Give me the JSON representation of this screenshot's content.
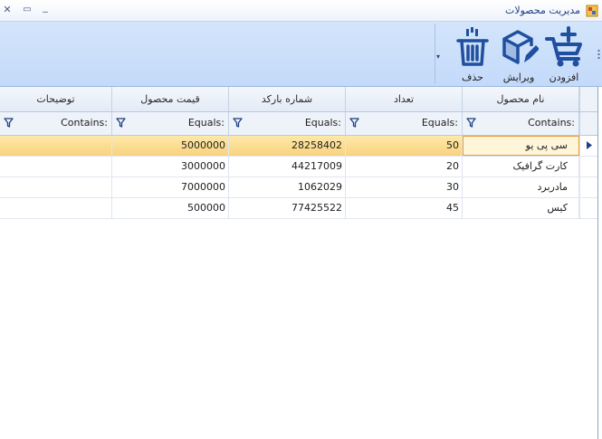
{
  "window": {
    "title": "مدیریت محصولات",
    "close_glyph": "✕",
    "restore_glyph": "▭",
    "minimize_glyph": "_"
  },
  "toolbar": {
    "add_label": "افزودن",
    "edit_label": "ویرایش",
    "delete_label": "حذف",
    "overflow_glyph": "▾"
  },
  "grid": {
    "columns": [
      "نام محصول",
      "تعداد",
      "شماره بارکد",
      "قیمت محصول",
      "توضیحات"
    ],
    "filters": [
      "Contains:",
      "Equals:",
      "Equals:",
      "Equals:",
      "Contains:"
    ],
    "rows": [
      [
        "سی پی یو",
        "50",
        "28258402",
        "5000000",
        ""
      ],
      [
        "کارت گرافیک",
        "20",
        "44217009",
        "3000000",
        ""
      ],
      [
        "مادربرد",
        "30",
        "1062029",
        "7000000",
        ""
      ],
      [
        "کیس",
        "45",
        "77425522",
        "500000",
        ""
      ]
    ],
    "selected_row": 0
  },
  "colors": {
    "ribbon": "#c8defb",
    "selected_row": "#f9d27e",
    "focus_border": "#e99a35",
    "icon_blue": "#1f4f9e"
  },
  "icons": {
    "add": "cart-plus-icon",
    "edit": "box-pencil-icon",
    "delete": "trash-icon",
    "filter": "funnel-icon",
    "row_indicator": "arrow-right-icon"
  }
}
